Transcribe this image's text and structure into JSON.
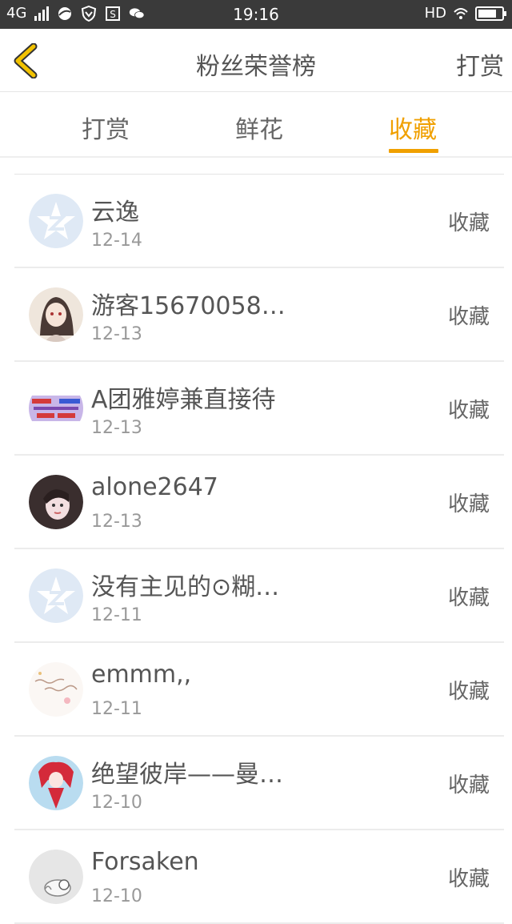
{
  "status_bar": {
    "network": "4G",
    "time": "19:16",
    "hd": "HD",
    "battery_level": 0.8
  },
  "header": {
    "title": "粉丝荣誉榜",
    "action": "打赏"
  },
  "tabs": [
    {
      "label": "打赏",
      "active": false
    },
    {
      "label": "鲜花",
      "active": false
    },
    {
      "label": "收藏",
      "active": true
    }
  ],
  "list": [
    {
      "name": "云逸",
      "date": "12-14",
      "action": "收藏",
      "avatar": "default-qq-avatar"
    },
    {
      "name": "游客15670058…",
      "date": "12-13",
      "action": "收藏",
      "avatar": "anime-girl-avatar"
    },
    {
      "name": "A团雅婷兼直接待",
      "date": "12-13",
      "action": "收藏",
      "avatar": "text-banner-avatar"
    },
    {
      "name": "alone2647",
      "date": "12-13",
      "action": "收藏",
      "avatar": "girl-photo-avatar"
    },
    {
      "name": "没有主见的⊙糊…",
      "date": "12-11",
      "action": "收藏",
      "avatar": "default-qq-avatar"
    },
    {
      "name": "emmm,,",
      "date": "12-11",
      "action": "收藏",
      "avatar": "handwriting-avatar"
    },
    {
      "name": "绝望彼岸——曼…",
      "date": "12-10",
      "action": "收藏",
      "avatar": "anime-red-avatar"
    },
    {
      "name": "Forsaken",
      "date": "12-10",
      "action": "收藏",
      "avatar": "cat-sketch-avatar"
    }
  ],
  "colors": {
    "accent": "#f0a000",
    "back_arrow": "#f2c200",
    "status_bar_bg": "#3a3a3a"
  }
}
